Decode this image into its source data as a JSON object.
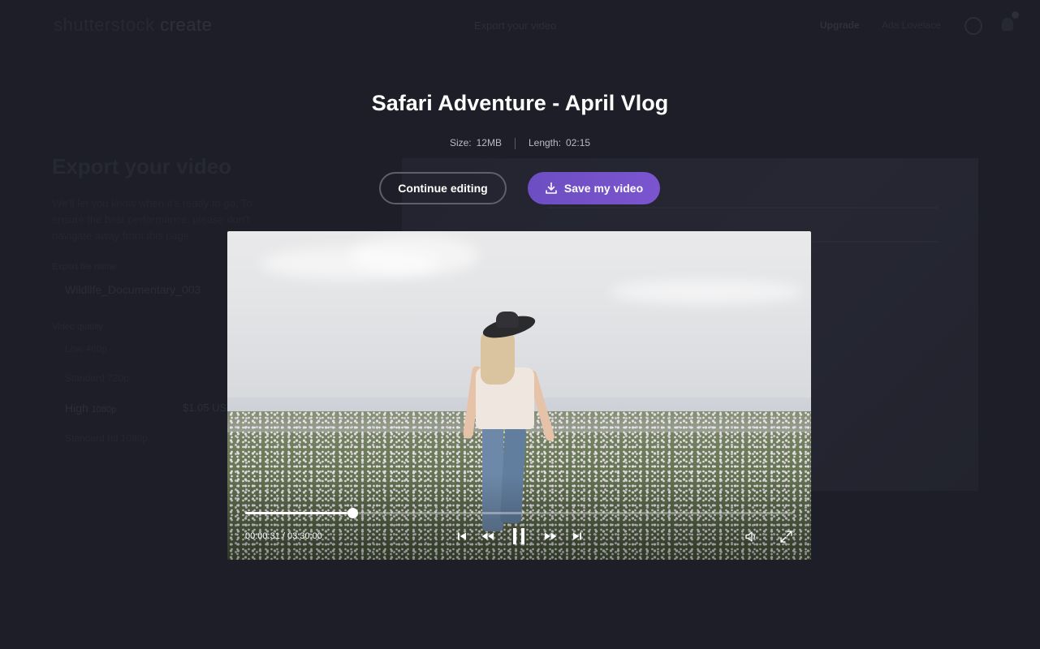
{
  "app": {
    "logo_prefix": "shutterstock",
    "logo_brand": "create",
    "header_title": "Export your video",
    "upgrade_label": "Upgrade",
    "user_label": "Ada Lovelace"
  },
  "background_panel": {
    "heading": "Export your video",
    "description": "We'll let you know when it's ready to go. To ensure the best performance, please don't navigate away from this page.",
    "filename_label": "Export file name",
    "filename_value": "Wildlife_Documentary_003",
    "quality_label": "Video quality",
    "options": [
      {
        "label": "Low",
        "detail": "480p"
      },
      {
        "label": "Standard",
        "detail": "720p"
      },
      {
        "label": "High",
        "detail": "1080p",
        "price": "$1.05 USD"
      },
      {
        "label": "Standard hd",
        "detail": "1080p"
      }
    ]
  },
  "modal": {
    "title": "Safari Adventure - April Vlog",
    "size_key": "Size:",
    "size_value": "12MB",
    "length_key": "Length:",
    "length_value": "02:15",
    "continue_label": "Continue editing",
    "save_label": "Save my video"
  },
  "player": {
    "time_display": "00:00:31 / 03:30:00",
    "progress_fraction": 0.195,
    "icons": {
      "skip_back": "skip-back-icon",
      "rewind": "rewind-icon",
      "pause": "pause-icon",
      "fast_forward": "fast-forward-icon",
      "skip_forward": "skip-forward-icon",
      "volume": "volume-icon",
      "fullscreen": "fullscreen-icon"
    }
  },
  "colors": {
    "background": "#1d1e28",
    "accent": "#7652cb",
    "text": "#ffffff"
  }
}
